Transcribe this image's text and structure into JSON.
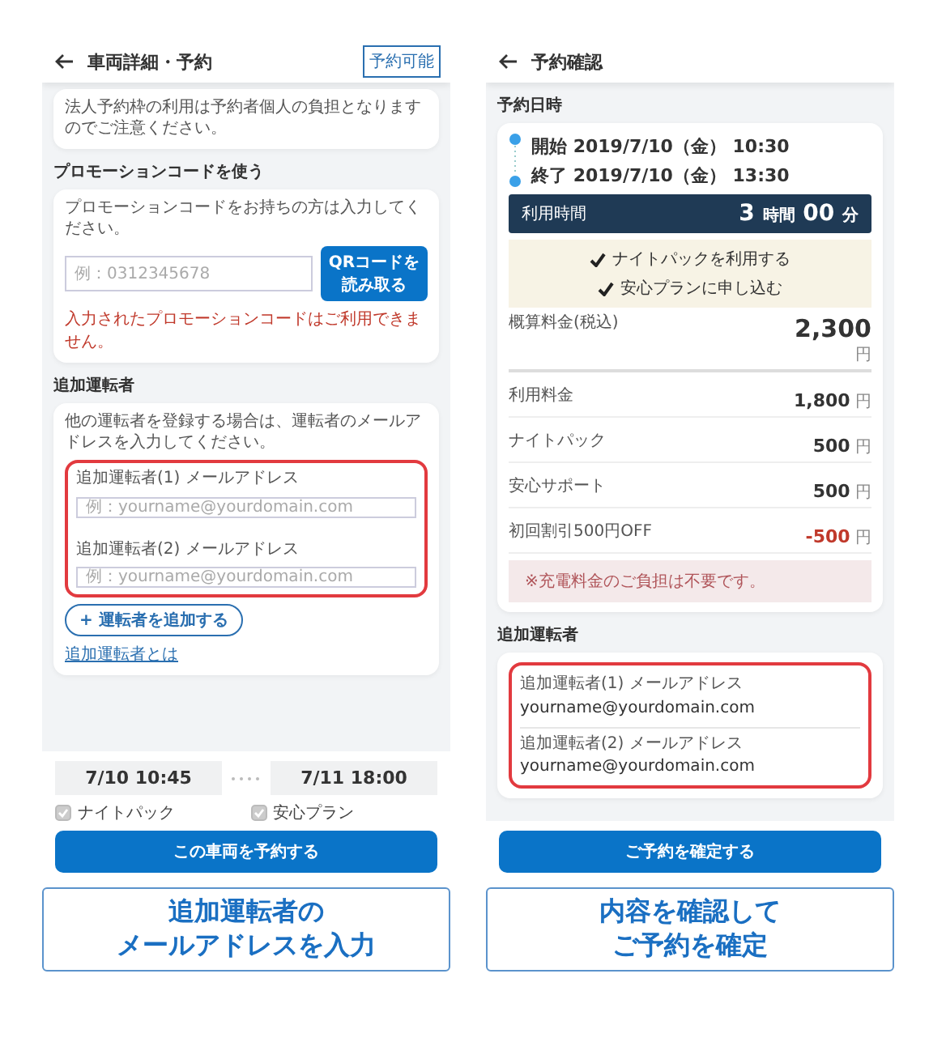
{
  "left_screen": {
    "header": {
      "title": "車両詳細・予約",
      "badge": "予約可能"
    },
    "notice": "法人予約枠の利用は予約者個人の負担となりますのでご注意ください。",
    "promo": {
      "heading": "プロモーションコードを使う",
      "description": "プロモーションコードをお持ちの方は入力してください。",
      "placeholder": "例：0312345678",
      "button": "QRコードを読み取る",
      "error": "入力されたプロモーションコードはご利用できません。"
    },
    "drivers": {
      "heading": "追加運転者",
      "description": "他の運転者を登録する場合は、運転者のメールアドレスを入力してください。",
      "highlighted": true,
      "fields": [
        {
          "label": "追加運転者(1) メールアドレス",
          "placeholder": "例：yourname@yourdomain.com"
        },
        {
          "label": "追加運転者(2) メールアドレス",
          "placeholder": "例：yourname@yourdomain.com"
        }
      ],
      "add_button": "+ 運転者を追加する",
      "link": "追加運転者とは"
    },
    "footer": {
      "start": "7/10 10:45",
      "end": "7/11 18:00",
      "options": [
        {
          "label": "ナイトパック",
          "checked": true
        },
        {
          "label": "安心プラン",
          "checked": true
        }
      ],
      "submit": "この車両を予約する"
    },
    "caption": [
      "追加運転者の",
      "メールアドレスを入力"
    ]
  },
  "right_screen": {
    "header": {
      "title": "予約確認"
    },
    "schedule": {
      "heading": "予約日時",
      "rows": [
        {
          "label": "開始",
          "date": "2019/7/10（金）",
          "time": "10:30"
        },
        {
          "label": "終了",
          "date": "2019/7/10（金）",
          "time": "13:30"
        }
      ],
      "duration": {
        "label": "利用時間",
        "hours": "3",
        "hours_unit": "時間",
        "minutes": "00",
        "minutes_unit": "分"
      },
      "options": [
        "ナイトパックを利用する",
        "安心プランに申し込む"
      ]
    },
    "estimate": {
      "label": "概算料金(税込)",
      "amount": "2,300",
      "unit": "円",
      "items": [
        {
          "label": "利用料金",
          "amount": "1,800",
          "unit": "円",
          "kind": "charge"
        },
        {
          "label": "ナイトパック",
          "amount": "500",
          "unit": "円",
          "kind": "charge"
        },
        {
          "label": "安心サポート",
          "amount": "500",
          "unit": "円",
          "kind": "charge"
        },
        {
          "label": "初回割引500円OFF",
          "amount": "-500",
          "unit": "円",
          "kind": "discount"
        }
      ],
      "note": "※充電料金のご負担は不要です。"
    },
    "drivers": {
      "heading": "追加運転者",
      "highlighted": true,
      "entries": [
        {
          "label": "追加運転者(1) メールアドレス",
          "value": "yourname@yourdomain.com"
        },
        {
          "label": "追加運転者(2) メールアドレス",
          "value": "yourname@yourdomain.com"
        }
      ]
    },
    "submit": "ご予約を確定する",
    "caption": [
      "内容を確認して",
      "ご予約を確定"
    ]
  }
}
